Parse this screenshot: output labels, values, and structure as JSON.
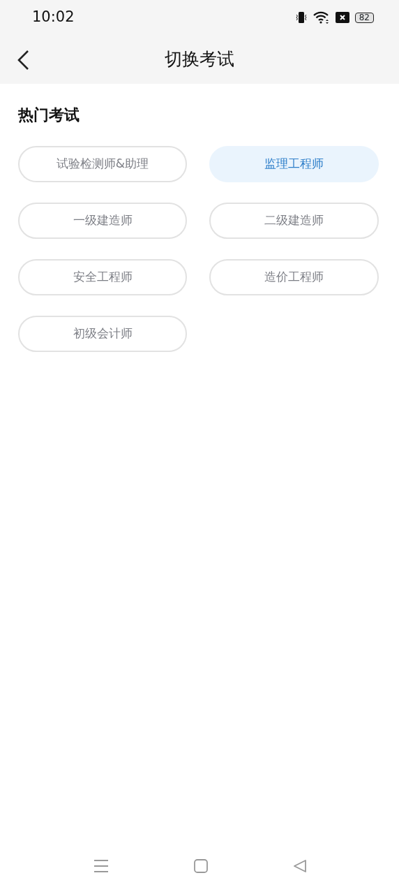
{
  "status_bar": {
    "time": "10:02",
    "battery": "82"
  },
  "header": {
    "title": "切换考试"
  },
  "section": {
    "title": "热门考试"
  },
  "exams": [
    {
      "label": "试验检测师&助理",
      "selected": false
    },
    {
      "label": "监理工程师",
      "selected": true
    },
    {
      "label": "一级建造师",
      "selected": false
    },
    {
      "label": "二级建造师",
      "selected": false
    },
    {
      "label": "安全工程师",
      "selected": false
    },
    {
      "label": "造价工程师",
      "selected": false
    },
    {
      "label": "初级会计师",
      "selected": false
    }
  ]
}
